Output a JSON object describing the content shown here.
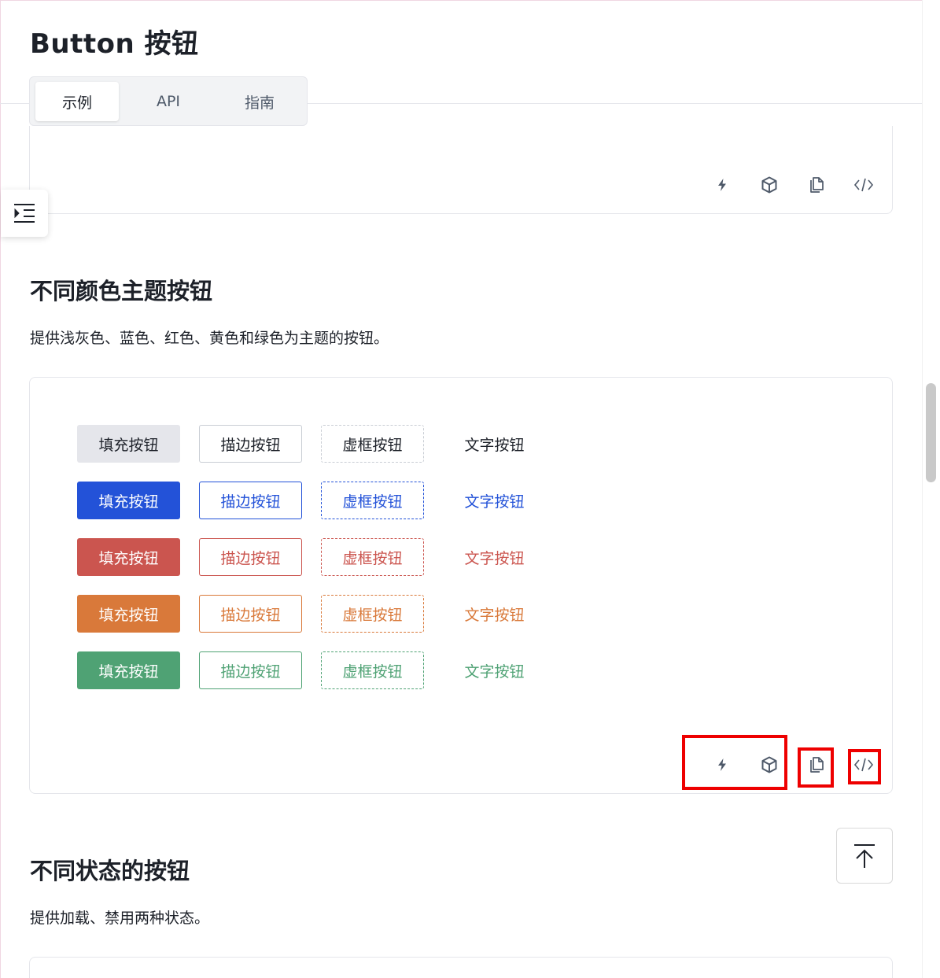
{
  "page": {
    "title": "Button 按钮"
  },
  "tabs": [
    {
      "label": "示例",
      "active": true
    },
    {
      "label": "API",
      "active": false
    },
    {
      "label": "指南",
      "active": false
    }
  ],
  "toolbar_icons": [
    "lightning-icon",
    "cube-icon",
    "copy-icon",
    "code-icon"
  ],
  "section_colors": {
    "title": "不同颜色主题按钮",
    "description": "提供浅灰色、蓝色、红色、黄色和绿色为主题的按钮。",
    "button_labels": {
      "fill": "填充按钮",
      "outline": "描边按钮",
      "dashed": "虚框按钮",
      "text": "文字按钮"
    },
    "themes": [
      {
        "name": "gray",
        "fill_bg": "#e5e6eb",
        "fill_text": "#1d2129",
        "color": "#c9cdd4",
        "text_color": "#1d2129"
      },
      {
        "name": "blue",
        "fill_bg": "#2352d8",
        "fill_text": "#ffffff",
        "color": "#2352d8",
        "text_color": "#2352d8"
      },
      {
        "name": "red",
        "fill_bg": "#cb554f",
        "fill_text": "#ffffff",
        "color": "#cb554f",
        "text_color": "#cb554f"
      },
      {
        "name": "orange",
        "fill_bg": "#d9793a",
        "fill_text": "#ffffff",
        "color": "#d9793a",
        "text_color": "#d9793a"
      },
      {
        "name": "green",
        "fill_bg": "#4fa274",
        "fill_text": "#ffffff",
        "color": "#4fa274",
        "text_color": "#4fa274"
      }
    ]
  },
  "section_states": {
    "title": "不同状态的按钮",
    "description": "提供加载、禁用两种状态。"
  },
  "colors": {
    "highlight": "#ee0000",
    "icon": "#4e5969"
  }
}
